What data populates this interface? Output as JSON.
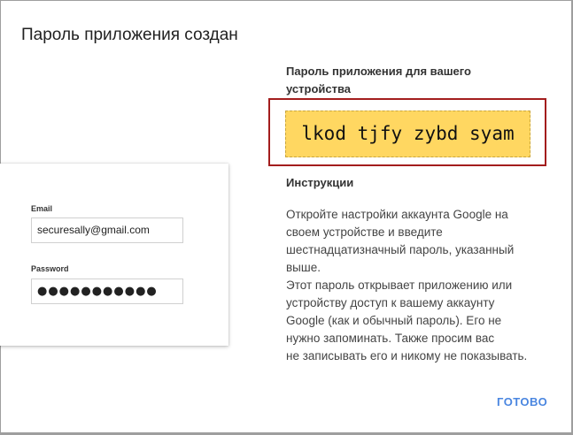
{
  "dialog": {
    "title": "Пароль приложения создан"
  },
  "login_card": {
    "email_label": "Email",
    "email_value": "securesally@gmail.com",
    "password_label": "Password",
    "password_value": "●●●●●●●●●●●"
  },
  "password_section": {
    "heading": "Пароль приложения для вашего устройства",
    "app_password": "lkod tjfy zybd syam"
  },
  "instructions": {
    "heading": "Инструкции",
    "text": "Откройте настройки аккаунта Google на\nсвоем устройстве и введите\nшестнадцатизначный пароль, указанный\nвыше.\nЭтот пароль открывает приложению или\nустройству доступ к вашему аккаунту\nGoogle (как и обычный пароль). Его не\nнужно запоминать. Также просим вас\nне записывать его и никому не показывать."
  },
  "actions": {
    "done_label": "ГОТОВО"
  },
  "colors": {
    "accent": "#4a86e0",
    "password_bg": "#ffd761",
    "highlight_border": "#a31d1d"
  }
}
